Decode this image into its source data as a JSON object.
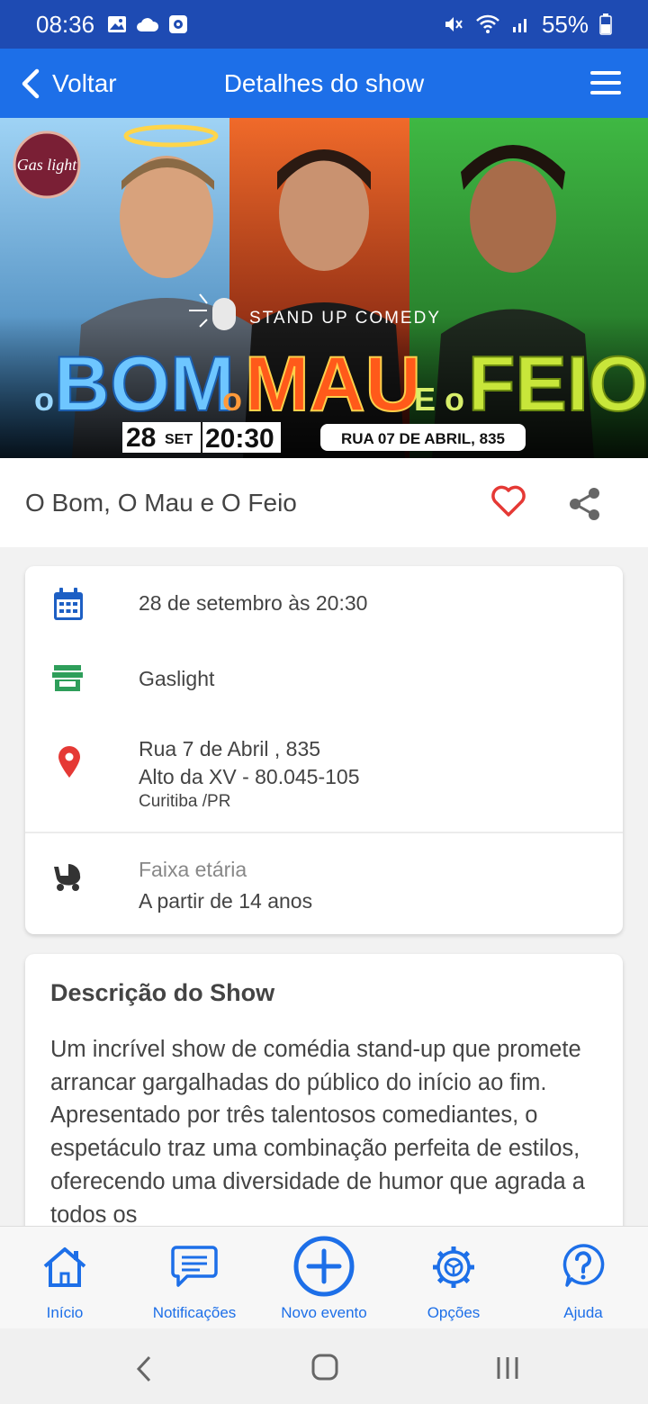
{
  "status_bar": {
    "time": "08:36",
    "battery": "55%"
  },
  "app_bar": {
    "back_label": "Voltar",
    "title": "Detalhes do show"
  },
  "poster": {
    "venue_logo": "Gas light",
    "subtitle": "STAND UP COMEDY",
    "title_parts": [
      "o",
      "BOM",
      "o",
      "MAU",
      "E o",
      "FEIO"
    ],
    "date_day": "28",
    "date_month": "SET",
    "time": "20:30",
    "address": "RUA 07 DE ABRIL, 835"
  },
  "show": {
    "title": "O Bom, O Mau e O Feio"
  },
  "info": {
    "date_text": "28 de setembro às 20:30",
    "venue": "Gaslight",
    "address_line1": "Rua 7 de Abril , 835",
    "address_line2": "Alto da XV - 80.045-105",
    "address_line3": "Curitiba /PR",
    "age_label": "Faixa etária",
    "age_value": "A partir de 14 anos"
  },
  "description": {
    "title": "Descrição do Show",
    "text": "Um incrível show de comédia stand-up que promete arrancar gargalhadas do público do início ao fim. Apresentado por três talentosos comediantes, o espetáculo traz uma combinação perfeita de estilos, oferecendo uma diversidade de humor que agrada a todos os"
  },
  "bottom_nav": {
    "items": [
      {
        "label": "Início",
        "icon": "home-icon"
      },
      {
        "label": "Notificações",
        "icon": "chat-icon"
      },
      {
        "label": "Novo evento",
        "icon": "plus-circle-icon"
      },
      {
        "label": "Opções",
        "icon": "gear-icon"
      },
      {
        "label": "Ajuda",
        "icon": "help-icon"
      }
    ]
  },
  "colors": {
    "primary": "#1d6fe8",
    "status_bar": "#1e4bb3",
    "heart": "#e53935",
    "pin": "#e53935",
    "venue_icon": "#2e9e5a"
  }
}
